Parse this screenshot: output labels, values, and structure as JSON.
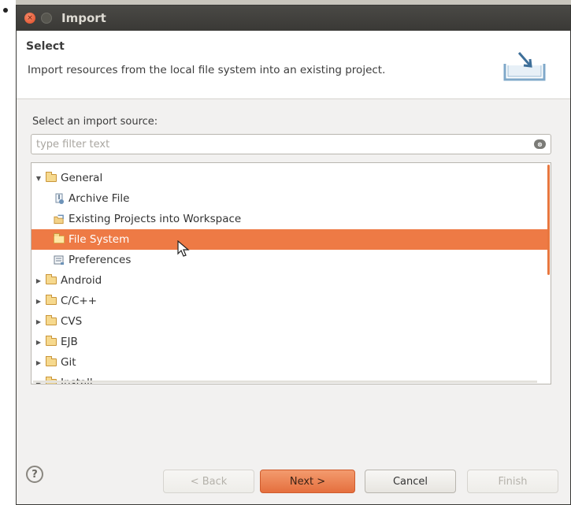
{
  "window": {
    "title": "Import"
  },
  "header": {
    "title": "Select",
    "description": "Import resources from the local file system into an existing project."
  },
  "source": {
    "label": "Select an import source:",
    "filter_placeholder": "type filter text"
  },
  "tree": {
    "items": [
      {
        "label": "General",
        "icon": "folder-open-icon",
        "expanded": true,
        "depth": 0,
        "selected": false
      },
      {
        "label": "Archive File",
        "icon": "archive-file-icon",
        "depth": 1,
        "selected": false
      },
      {
        "label": "Existing Projects into Workspace",
        "icon": "project-folder-icon",
        "depth": 1,
        "selected": false
      },
      {
        "label": "File System",
        "icon": "folder-icon",
        "depth": 1,
        "selected": true
      },
      {
        "label": "Preferences",
        "icon": "preferences-icon",
        "depth": 1,
        "selected": false
      },
      {
        "label": "Android",
        "icon": "folder-icon",
        "expanded": false,
        "depth": 0,
        "selected": false
      },
      {
        "label": "C/C++",
        "icon": "folder-icon",
        "expanded": false,
        "depth": 0,
        "selected": false
      },
      {
        "label": "CVS",
        "icon": "folder-icon",
        "expanded": false,
        "depth": 0,
        "selected": false
      },
      {
        "label": "EJB",
        "icon": "folder-icon",
        "expanded": false,
        "depth": 0,
        "selected": false
      },
      {
        "label": "Git",
        "icon": "folder-icon",
        "expanded": false,
        "depth": 0,
        "selected": false
      },
      {
        "label": "Install",
        "icon": "folder-icon",
        "expanded": false,
        "depth": 0,
        "selected": false
      }
    ]
  },
  "buttons": {
    "help": "?",
    "back": "< Back",
    "next": "Next >",
    "cancel": "Cancel",
    "finish": "Finish"
  },
  "colors": {
    "selection": "#ee7a45",
    "titlebar": "#3c3b37",
    "accent": "#e56f3e"
  }
}
